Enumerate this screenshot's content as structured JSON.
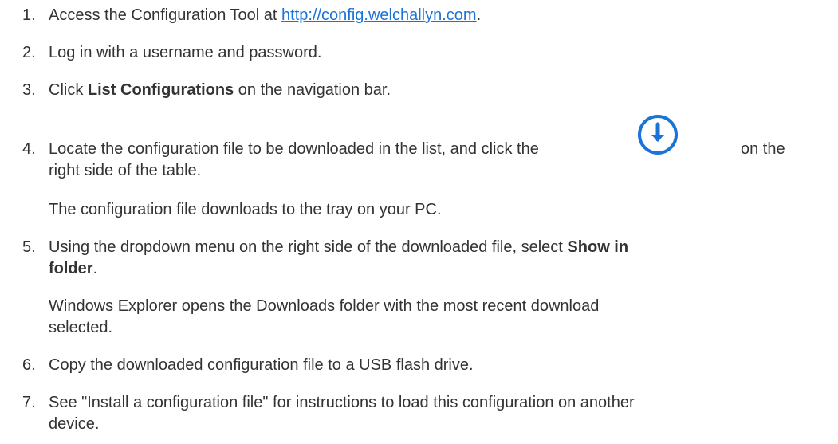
{
  "steps": [
    {
      "number": "1.",
      "before": "Access the Configuration Tool at ",
      "link": "http://config.welchallyn.com",
      "after": "."
    },
    {
      "number": "2.",
      "text": "Log in with a username and password."
    },
    {
      "number": "3.",
      "before": "Click ",
      "bold": "List Configurations",
      "after": " on the navigation bar."
    },
    {
      "number": "4.",
      "before": "Locate the configuration file to be downloaded in the list, and click the",
      "after_line1": "on the",
      "line2": "right side of the table.",
      "note": "The configuration file downloads to the tray on your PC."
    },
    {
      "number": "5.",
      "before": "Using the dropdown menu on the right side of the downloaded file, select ",
      "bold1": "Show in",
      "bold2": "folder",
      "after": ".",
      "note_line1": "Windows Explorer opens the Downloads folder with the most recent download",
      "note_line2": "selected."
    },
    {
      "number": "6.",
      "text": "Copy the downloaded configuration file to a USB flash drive."
    },
    {
      "number": "7.",
      "line1": "See \"Install a configuration file\" for instructions to load this configuration on another",
      "line2": "device."
    }
  ],
  "colors": {
    "text": "#333333",
    "link": "#1a73d8",
    "icon": "#1a73d8"
  },
  "icons": {
    "download": "download-circle-icon"
  }
}
